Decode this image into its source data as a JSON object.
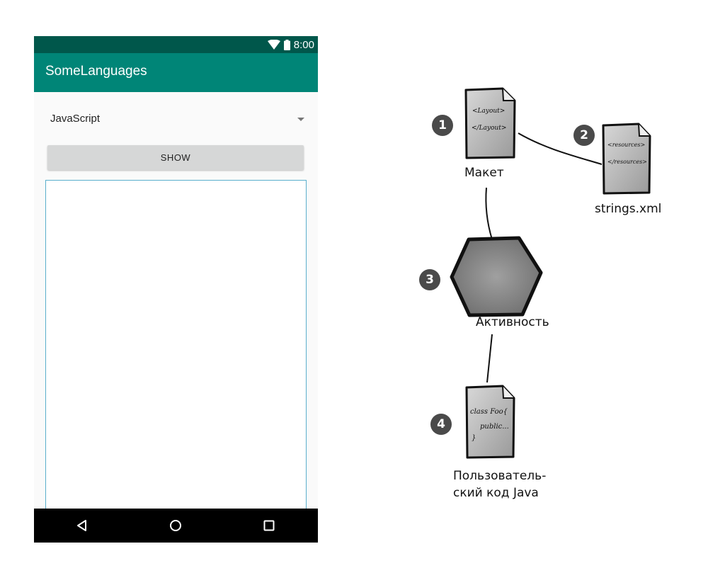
{
  "status_bar": {
    "time": "8:00"
  },
  "app": {
    "title": "SomeLanguages"
  },
  "spinner": {
    "selected": "JavaScript"
  },
  "show_button": {
    "label": "SHOW"
  },
  "diagram": {
    "nodes": [
      {
        "number": "1",
        "label": "Макет",
        "doc_lines": [
          "<Layout>",
          "</Layout>"
        ]
      },
      {
        "number": "2",
        "label": "strings.xml",
        "doc_lines": [
          "<resources>",
          "</resources>"
        ]
      },
      {
        "number": "3",
        "label": "Активность"
      },
      {
        "number": "4",
        "label_lines": [
          "Пользователь-",
          "ский код Java"
        ],
        "doc_lines": [
          "class Foo{",
          "public...",
          "}"
        ]
      }
    ]
  }
}
